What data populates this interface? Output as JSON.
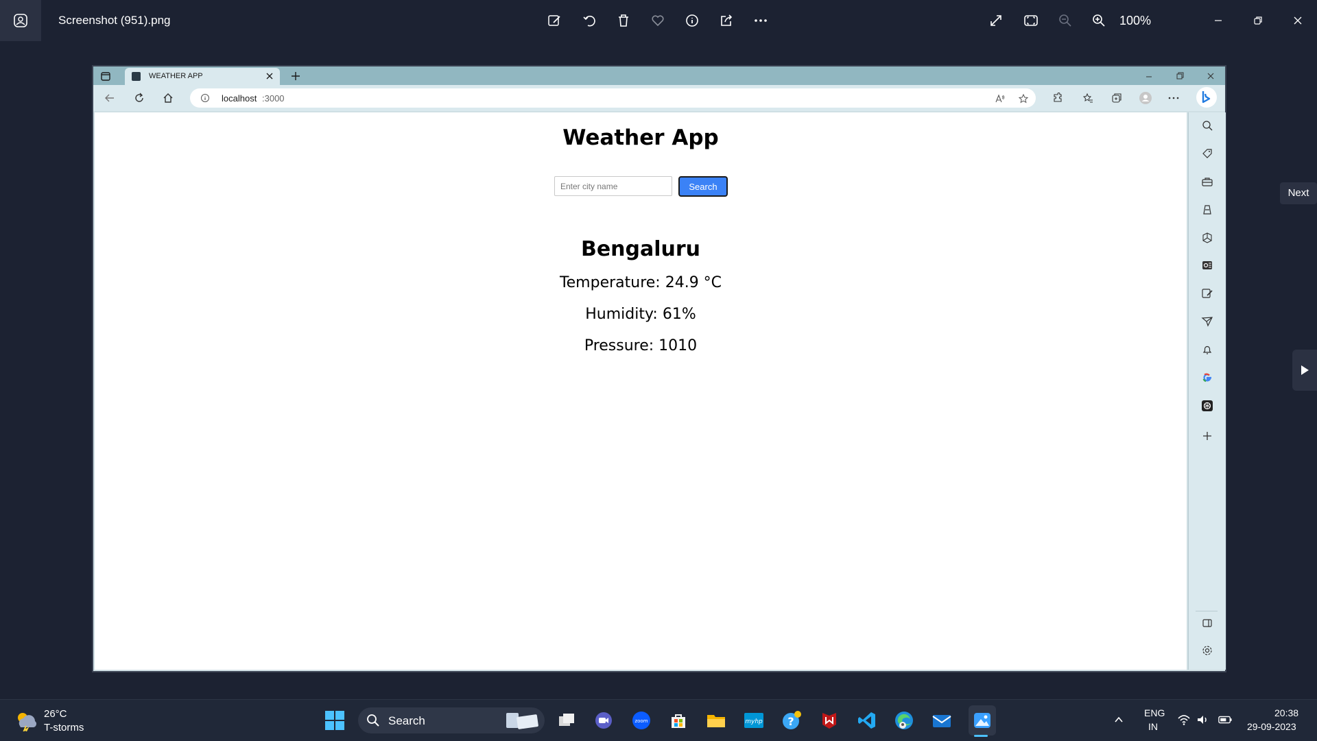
{
  "viewer": {
    "file_name": "Screenshot (951).png",
    "zoom": "100%"
  },
  "browser": {
    "tab_title": "WEATHER APP",
    "url_host": "localhost",
    "url_port": ":3000"
  },
  "app": {
    "title": "Weather App",
    "search_placeholder": "Enter city name",
    "search_button": "Search",
    "city": "Bengaluru",
    "temperature": "Temperature: 24.9 °C",
    "humidity": "Humidity: 61%",
    "pressure": "Pressure: 1010"
  },
  "viewer_nav": {
    "next_tooltip": "Next"
  },
  "taskbar": {
    "weather_temp": "26°C",
    "weather_cond": "T-storms",
    "search_label": "Search",
    "lang_line1": "ENG",
    "lang_line2": "IN",
    "time": "20:38",
    "date": "29-09-2023"
  },
  "colors": {
    "accent": "#3b82f6",
    "viewer_bg": "#1c2232",
    "browser_tabstrip": "#91b7c1",
    "browser_toolbar": "#dae9ee"
  }
}
